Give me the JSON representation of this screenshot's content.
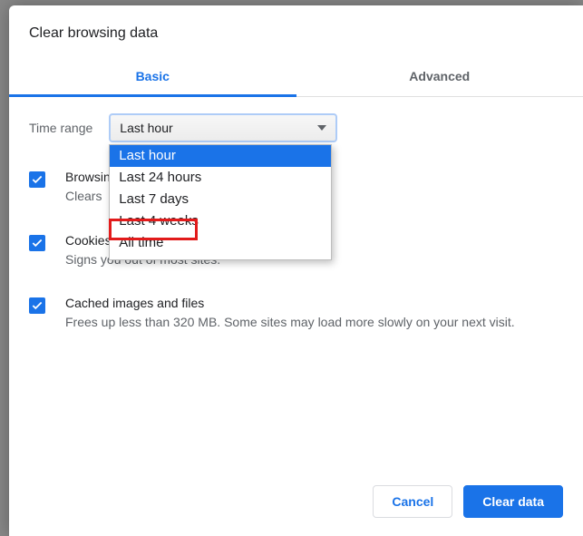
{
  "title": "Clear browsing data",
  "tabs": {
    "basic": "Basic",
    "advanced": "Advanced"
  },
  "timeRange": {
    "label": "Time range",
    "selected": "Last hour",
    "options": [
      "Last hour",
      "Last 24 hours",
      "Last 7 days",
      "Last 4 weeks",
      "All time"
    ],
    "highlightIndex": 4
  },
  "items": [
    {
      "title": "Browsing history",
      "titleTruncated": "Browsin",
      "desc": "Clears history",
      "descTruncated": "Clears "
    },
    {
      "title": "Cookies and other site data",
      "desc": "Signs you out of most sites."
    },
    {
      "title": "Cached images and files",
      "desc": "Frees up less than 320 MB. Some sites may load more slowly on your next visit."
    }
  ],
  "buttons": {
    "cancel": "Cancel",
    "confirm": "Clear data"
  },
  "colors": {
    "accent": "#1a73e8",
    "highlight": "#e21b1b"
  }
}
